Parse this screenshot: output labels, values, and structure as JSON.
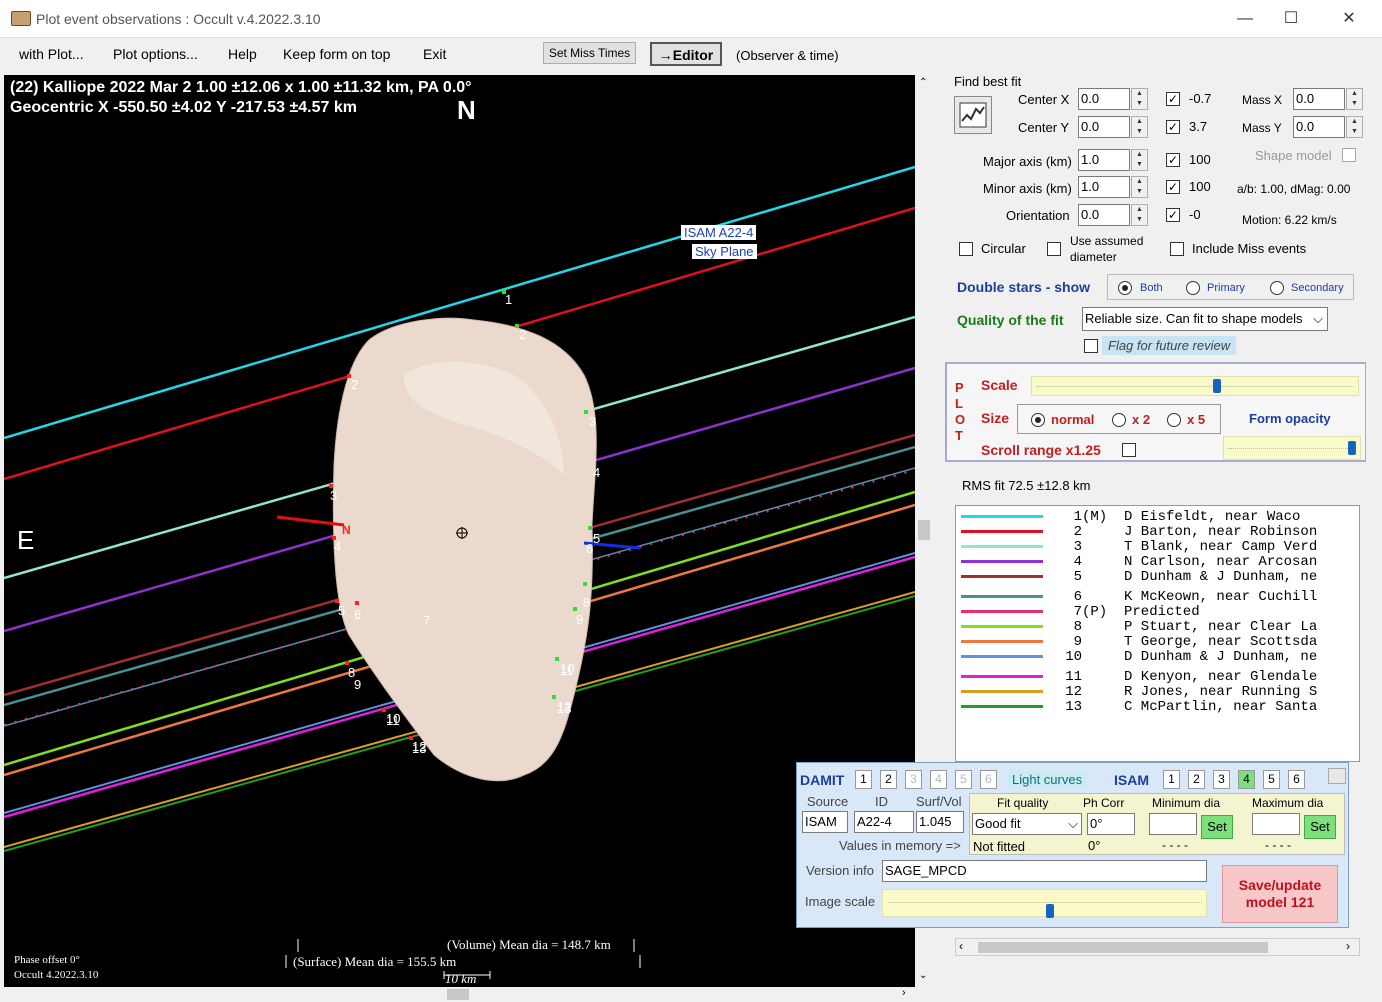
{
  "window": {
    "title": "Plot event observations : Occult v.4.2022.3.10",
    "minimize": "—",
    "maximize": "☐",
    "close": "✕"
  },
  "menu": [
    "with Plot...",
    "Plot options...",
    "Help",
    "Keep form on top",
    "Exit"
  ],
  "toolbar": {
    "set_miss_times": "Set Miss Times",
    "editor": "→Editor",
    "observer_time": "(Observer & time)"
  },
  "plot": {
    "header1": "(22) Kalliope  2022 Mar 2   1.00 ±12.06 x 1.00 ±11.32 km, PA 0.0°",
    "header2": "Geocentric  X  -550.50 ±4.02  Y -217.53 ±4.57 km",
    "north": "N",
    "east": "E",
    "model_label1": "ISAM A22-4",
    "model_label2": "Sky Plane",
    "vol_dia": "(Volume) Mean dia = 148.7 km",
    "surf_dia": "(Surface) Mean dia = 155.5 km",
    "scale": "10 km",
    "phase": "Phase offset 0°",
    "version": "Occult 4.2022.3.10",
    "chord_labels": [
      "1",
      "2",
      "2",
      "3",
      "3",
      "4",
      "4",
      "5",
      "6",
      "6",
      "5",
      "7",
      "8",
      "9",
      "8",
      "9",
      "10",
      "11",
      "10",
      "11",
      "12",
      "13",
      "12",
      "13"
    ]
  },
  "fit": {
    "title": "Find best fit",
    "center_x_label": "Center X",
    "center_x": "0.0",
    "center_y_label": "Center Y",
    "center_y": "0.0",
    "major_label": "Major axis (km)",
    "major": "1.0",
    "minor_label": "Minor axis (km)",
    "minor": "1.0",
    "orient_label": "Orientation",
    "orient": "0.0",
    "chk_vals": [
      "-0.7",
      "3.7",
      "100",
      "100",
      "-0"
    ],
    "mass_x_label": "Mass X",
    "mass_x": "0.0",
    "mass_y_label": "Mass Y",
    "mass_y": "0.0",
    "shape_model": "Shape model",
    "ab": "a/b: 1.00, dMag: 0.00",
    "motion": "Motion: 6.22 km/s",
    "circular": "Circular",
    "use_assumed": "Use assumed",
    "diameter": "diameter",
    "include_miss": "Include Miss events",
    "double_stars": "Double stars - show",
    "both": "Both",
    "primary": "Primary",
    "secondary": "Secondary",
    "quality_label": "Quality of the fit",
    "quality": "Reliable size. Can fit to shape models",
    "flag": "Flag for future review"
  },
  "plotpanel": {
    "p": "P",
    "l": "L",
    "o": "O",
    "t": "T",
    "scale": "Scale",
    "size": "Size",
    "normal": "normal",
    "x2": "x 2",
    "x5": "x 5",
    "form_opacity": "Form opacity",
    "scroll_range": "Scroll range x1.25",
    "scale_val": 0.57,
    "opacity_val": 0.97
  },
  "rms": "RMS fit  72.5 ±12.8 km",
  "observers": [
    {
      "num": "1",
      "tag": "(M)",
      "text": "D Eisfeldt, near Waco",
      "color": "#22d8e8"
    },
    {
      "num": "2",
      "tag": "",
      "text": "J Barton, near Robinson",
      "color": "#e01020"
    },
    {
      "num": "3",
      "tag": "",
      "text": "T Blank, near Camp Verd",
      "color": "#90e8c8"
    },
    {
      "num": "4",
      "tag": "",
      "text": "N Carlson, near Arcosan",
      "color": "#9030d0"
    },
    {
      "num": "5",
      "tag": "",
      "text": "D Dunham & J Dunham, ne",
      "color": "#a03030"
    },
    {
      "num": "6",
      "tag": "",
      "text": "K McKeown, near Cuchill",
      "color": "#4a9090"
    },
    {
      "num": "7",
      "tag": "(P)",
      "text": "Predicted",
      "color": "#e83070"
    },
    {
      "num": "8",
      "tag": "",
      "text": "P Stuart, near Clear La",
      "color": "#80e020"
    },
    {
      "num": "9",
      "tag": "",
      "text": "T George, near Scottsda",
      "color": "#f07840"
    },
    {
      "num": "10",
      "tag": "",
      "text": "D Dunham & J Dunham, ne",
      "color": "#6090e0"
    },
    {
      "num": "11",
      "tag": "",
      "text": "D Kenyon, near Glendale",
      "color": "#e020e0"
    },
    {
      "num": "12",
      "tag": "",
      "text": "R Jones, near Running S",
      "color": "#d8a020"
    },
    {
      "num": "13",
      "tag": "",
      "text": "C McPartlin, near Santa",
      "color": "#20a020"
    }
  ],
  "damit": {
    "damit_label": "DAMIT",
    "damit_tabs": [
      "1",
      "2",
      "3",
      "4",
      "5",
      "6"
    ],
    "light_curves": "Light curves",
    "isam_label": "ISAM",
    "isam_tabs": [
      "1",
      "2",
      "3",
      "4",
      "5",
      "6"
    ],
    "source_h": "Source",
    "id_h": "ID",
    "surfvol_h": "Surf/Vol",
    "fitq_h": "Fit quality",
    "phcorr_h": "Ph Corr",
    "mindia_h": "Minimum dia",
    "maxdia_h": "Maximum dia",
    "source": "ISAM",
    "id": "A22-4",
    "surfvol": "1.045",
    "fitq": "Good fit",
    "phcorr": "0°",
    "set": "Set",
    "values_mem": "Values in memory =>",
    "not_fitted": "Not fitted",
    "phcorr2": "0°",
    "dash1": "- - - -",
    "dash2": "- - - -",
    "version_label": "Version info",
    "version": "SAGE_MPCD",
    "image_scale": "Image scale",
    "image_scale_val": 0.52,
    "save1": "Save/update",
    "save2": "model 121"
  }
}
